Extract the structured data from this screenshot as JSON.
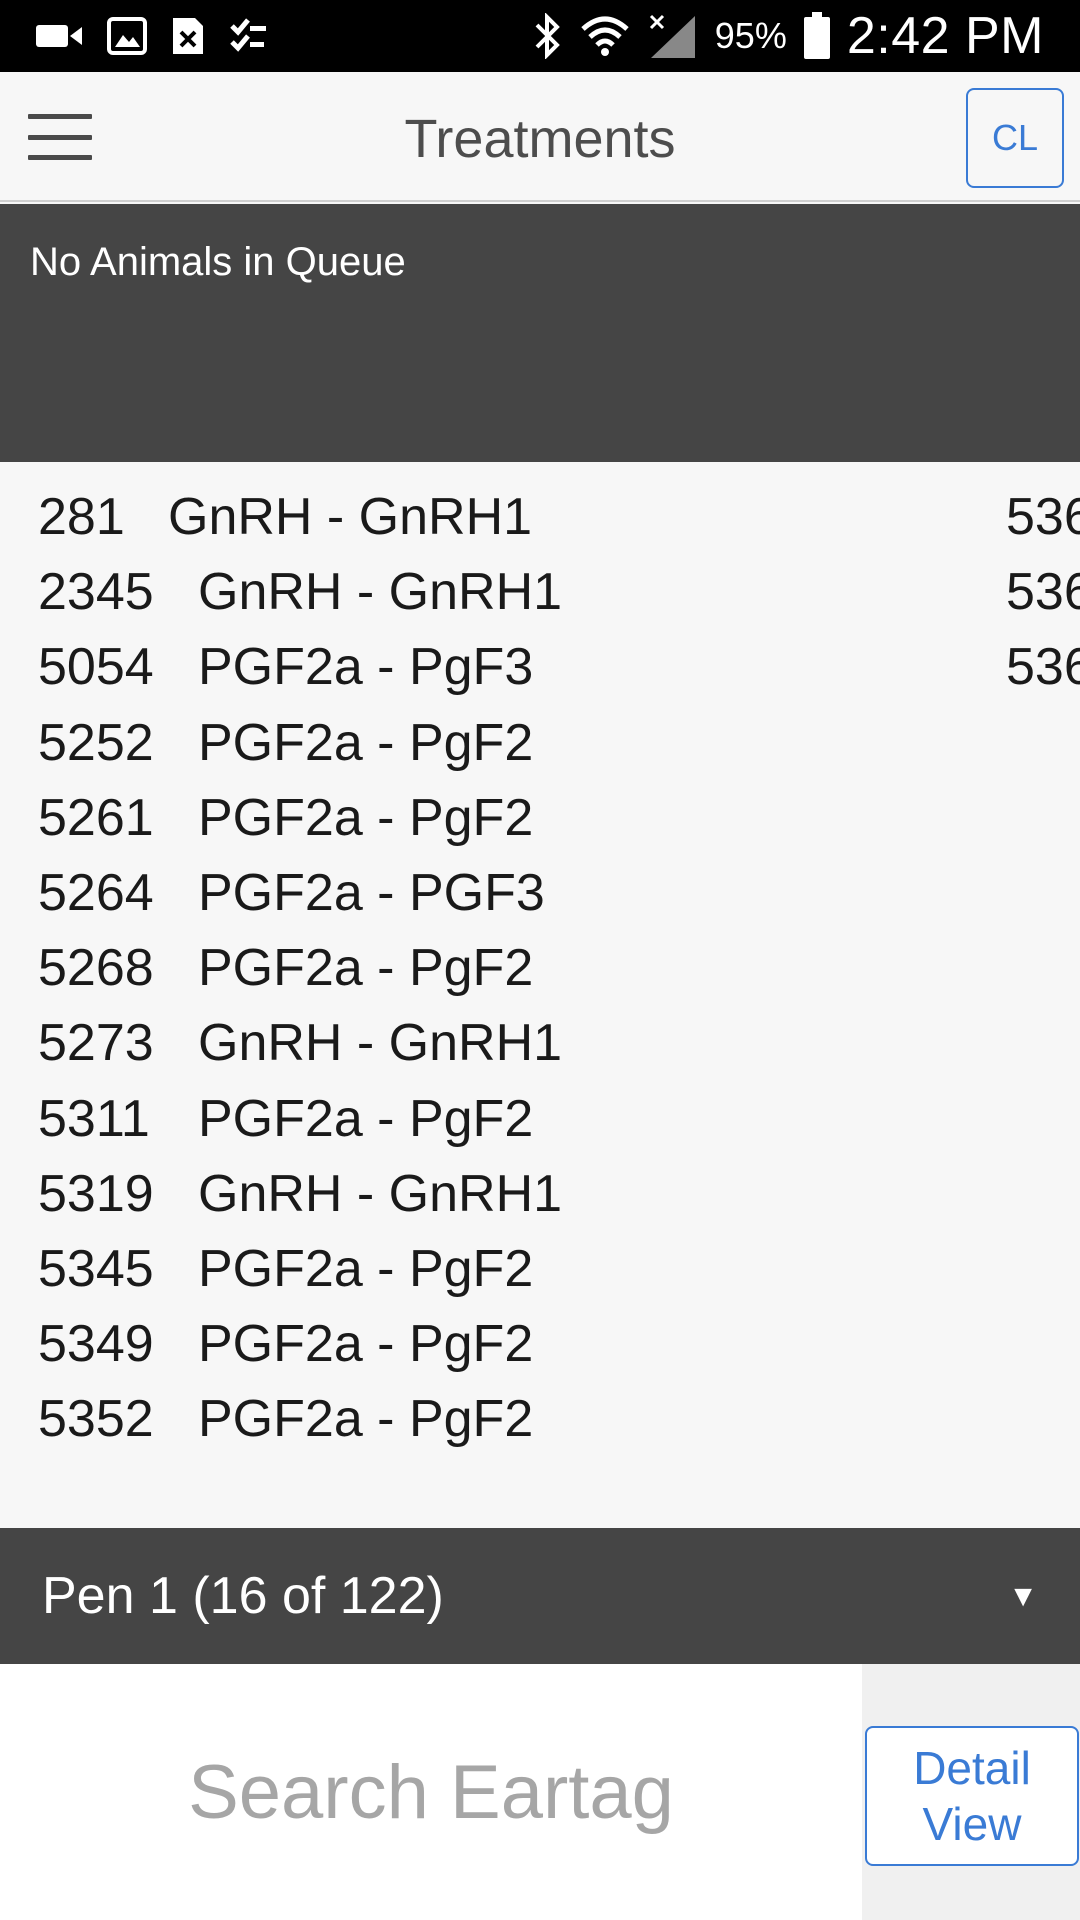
{
  "status_bar": {
    "battery_percent": "95%",
    "time": "2:42 PM",
    "left_icons": [
      "video-icon",
      "image-icon",
      "file-icon",
      "checklist-icon"
    ],
    "right_icons": [
      "bluetooth-icon",
      "wifi-icon",
      "no-signal-icon",
      "battery-icon"
    ]
  },
  "app_bar": {
    "title": "Treatments",
    "cl_label": "CL",
    "menu_icon": "hamburger-menu-icon"
  },
  "queue": {
    "message": "No Animals in Queue"
  },
  "treatments": {
    "rows": [
      {
        "tag": "281",
        "treatment": "GnRH - GnRH1"
      },
      {
        "tag": "2345",
        "treatment": "GnRH - GnRH1"
      },
      {
        "tag": "5054",
        "treatment": "PGF2a - PgF3"
      },
      {
        "tag": "5252",
        "treatment": "PGF2a - PgF2"
      },
      {
        "tag": "5261",
        "treatment": "PGF2a - PgF2"
      },
      {
        "tag": "5264",
        "treatment": "PGF2a - PGF3"
      },
      {
        "tag": "5268",
        "treatment": "PGF2a - PgF2"
      },
      {
        "tag": "5273",
        "treatment": "GnRH - GnRH1"
      },
      {
        "tag": "5311",
        "treatment": "PGF2a - PgF2"
      },
      {
        "tag": "5319",
        "treatment": "GnRH - GnRH1"
      },
      {
        "tag": "5345",
        "treatment": "PGF2a - PgF2"
      },
      {
        "tag": "5349",
        "treatment": "PGF2a - PgF2"
      },
      {
        "tag": "5352",
        "treatment": "PGF2a - PgF2"
      }
    ],
    "second_column_partial": [
      "536",
      "536",
      "536"
    ]
  },
  "pen": {
    "label": "Pen 1 (16 of 122)",
    "arrow": "▼"
  },
  "search": {
    "placeholder": "Search Eartag",
    "value": ""
  },
  "detail_view": {
    "label_line1": "Detail",
    "label_line2": "View"
  },
  "colors": {
    "accent": "#3a7bd5",
    "dark_panel": "#454545",
    "background": "#f7f7f7"
  }
}
